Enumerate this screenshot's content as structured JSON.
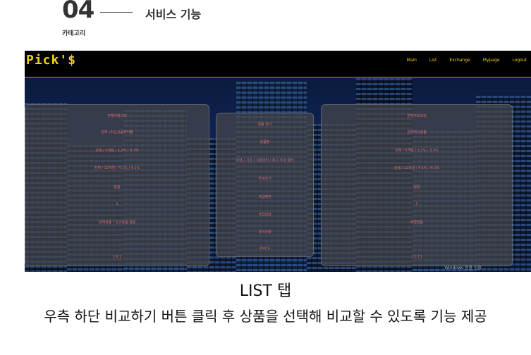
{
  "header": {
    "number": "04",
    "section_title": "서비스 기능",
    "category_label": "카테고리"
  },
  "app": {
    "logo": "Pick'$",
    "nav": [
      "Main",
      "List",
      "Exchange",
      "Mypage",
      "Logout"
    ]
  },
  "panels": {
    "left": {
      "items": [
        "전체카테고리",
        "전체→최근상품레이블",
        "전체 / 6개월 / 3.3% / 3.3%",
        "전체 / 12개월 / 4.1% / 4.1%",
        "없음",
        "1",
        "전체상품 / 신규상품 전용",
        "-",
        "[ 0 ]"
      ]
    },
    "middle": {
      "items": [
        "금융 회사",
        "상품명",
        "유형 / 기간 / 기본금리 / 최고 우대 금리",
        "우대조건",
        "가입제한",
        "가입대상",
        "유의사항",
        "Pick'$"
      ]
    },
    "right": {
      "items": [
        "전체카테고리",
        "전체최신상품",
        "전체 / 6개월 / 3.3% / 3.3%",
        "전체 / 12개월 / 4.1% / 4.1%",
        "없음",
        "1",
        "제한없음",
        "-",
        "[ 1.7 ]"
      ]
    },
    "status_text": "Windows 정품 인증"
  },
  "captions": {
    "tab_title": "LIST 탭",
    "description": "우측 하단 비교하기 버튼 클릭 후 상품을 선택해 비교할 수 있도록 기능 제공"
  },
  "colors": {
    "accent": "#f2d01a",
    "panel_text": "#e26b6b"
  }
}
